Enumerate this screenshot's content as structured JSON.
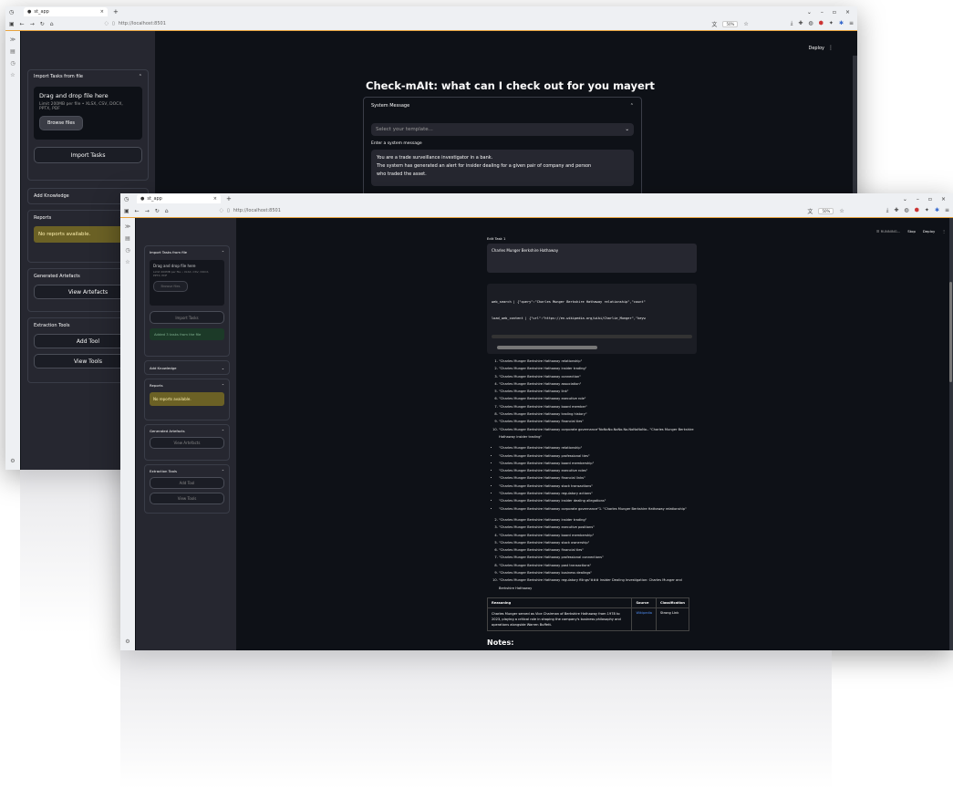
{
  "back_window": {
    "tab_title": "st_app",
    "url": "http://localhost:8501",
    "zoom": "50%",
    "header_action": "Deploy",
    "page_title": "Check-mAIt: what can I check out for you mayert",
    "sidebar": {
      "import_tasks_header": "Import Tasks from file",
      "dropzone_title": "Drag and drop file here",
      "dropzone_limit": "Limit 200MB per file • XLSX, CSV, DOCX, PPTX, PDF",
      "browse_button": "Browse files",
      "import_tasks_button": "Import Tasks",
      "add_knowledge_header": "Add Knowledge",
      "reports_header": "Reports",
      "no_reports": "No reports available.",
      "artefacts_header": "Generated Artefacts",
      "view_artefacts_button": "View Artefacts",
      "extraction_header": "Extraction Tools",
      "add_tool_button": "Add Tool",
      "view_tools_button": "View Tools"
    },
    "system_message": {
      "header": "System Message",
      "select_placeholder": "Select your template...",
      "input_label": "Enter a system message",
      "text_lines": [
        "You are a trade surveillance investigator in a bank.",
        "The system has generated an alert for insider dealing for a given pair of company and person",
        "who traded the asset."
      ]
    }
  },
  "front_window": {
    "tab_title": "st_app",
    "url": "http://localhost:8501",
    "zoom": "50%",
    "running_label": "RUNNING...",
    "stop_label": "Stop",
    "deploy_label": "Deploy",
    "sidebar": {
      "import_tasks_header": "Import Tasks from file",
      "dropzone_title": "Drag and drop file here",
      "dropzone_limit": "Limit 200MB per file • XLSX, CSV, DOCX, PPTX, PDF",
      "browse_button": "Browse files",
      "import_tasks_button": "Import Tasks",
      "success_msg": "Added 3 tasks from the file",
      "add_knowledge_header": "Add Knowledge",
      "reports_header": "Reports",
      "no_reports": "No reports available.",
      "artefacts_header": "Generated Artefacts",
      "view_artefacts_button": "View Artefacts",
      "extraction_header": "Extraction Tools",
      "add_tool_button": "Add Tool",
      "view_tools_button": "View Tools"
    },
    "edit_task_label": "Edit Task 1",
    "task_text": "Charles Munger Berkshire Hathaway",
    "code_lines": [
      "web_search | {\"query\":\"Charles Munger Berkshire Hathaway relationship\",\"count\"",
      "load_web_content | {\"url\":\"https://en.wikipedia.org/wiki/Charlie_Munger\",\"keyw"
    ],
    "list1": [
      "\"Charles Munger Berkshire Hathaway relationship\"",
      "\"Charles Munger Berkshire Hathaway insider trading\"",
      "\"Charles Munger Berkshire Hathaway connection\"",
      "\"Charles Munger Berkshire Hathaway association\"",
      "\"Charles Munger Berkshire Hathaway link\"",
      "\"Charles Munger Berkshire Hathaway executive role\"",
      "\"Charles Munger Berkshire Hathaway board member\"",
      "\"Charles Munger Berkshire Hathaway trading history\"",
      "\"Charles Munger Berkshire Hathaway financial ties\"",
      "\"Charles Munger Berkshire Hathaway corporate governance\"NoNoNo.NoNo.No.NoNoNoNo.- \"Charles Munger Berkshire Hathaway insider trading\""
    ],
    "list2": [
      "\"Charles Munger Berkshire Hathaway relationship\"",
      "\"Charles Munger Berkshire Hathaway professional ties\"",
      "\"Charles Munger Berkshire Hathaway board membership\"",
      "\"Charles Munger Berkshire Hathaway executive roles\"",
      "\"Charles Munger Berkshire Hathaway financial links\"",
      "\"Charles Munger Berkshire Hathaway stock transactions\"",
      "\"Charles Munger Berkshire Hathaway regulatory actions\"",
      "\"Charles Munger Berkshire Hathaway insider dealing allegations\"",
      "\"Charles Munger Berkshire Hathaway corporate governance\"1. \"Charles Munger Berkshire Hathaway relationship\""
    ],
    "list3_start": 2,
    "list3": [
      "\"Charles Munger Berkshire Hathaway insider trading\"",
      "\"Charles Munger Berkshire Hathaway executive positions\"",
      "\"Charles Munger Berkshire Hathaway board membership\"",
      "\"Charles Munger Berkshire Hathaway stock ownership\"",
      "\"Charles Munger Berkshire Hathaway financial ties\"",
      "\"Charles Munger Berkshire Hathaway professional connections\"",
      "\"Charles Munger Berkshire Hathaway past transactions\"",
      "\"Charles Munger Berkshire Hathaway business dealings\"",
      "\"Charles Munger Berkshire Hathaway regulatory filings\"### Insider Dealing Investigation: Charles Munger and Berkshire Hathaway"
    ],
    "table": {
      "headers": [
        "Reasoning",
        "Source",
        "Classification"
      ],
      "row": {
        "reasoning": "Charles Munger served as Vice Chairman of Berkshire Hathaway from 1978 to 2023, playing a critical role in shaping the company's business philosophy and operations alongside Warren Buffett.",
        "source": "Wikipedia",
        "classification": "Strong Link"
      }
    },
    "notes_heading": "Notes:"
  },
  "colors": {
    "app_bg": "#0e1117",
    "sidebar_bg": "#262730",
    "warning_bg": "#6b6125",
    "success_bg": "#1c3a28",
    "link": "#4f8ff7",
    "accent": "#e8a33d"
  }
}
